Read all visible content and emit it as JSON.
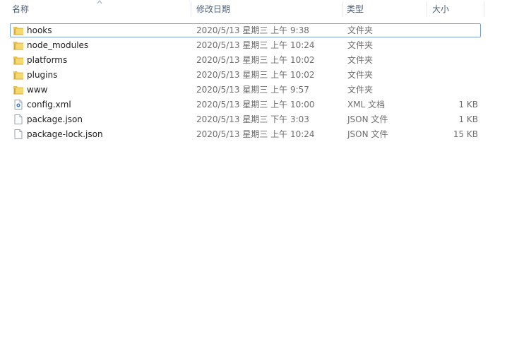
{
  "columns": {
    "name": "名称",
    "date": "修改日期",
    "type": "类型",
    "size": "大小"
  },
  "sort": {
    "column": "name",
    "direction": "ascending"
  },
  "files": [
    {
      "name": "hooks",
      "date": "2020/5/13 星期三 上午 9:38",
      "type": "文件夹",
      "size": "",
      "icon": "folder-icon",
      "focused": true
    },
    {
      "name": "node_modules",
      "date": "2020/5/13 星期三 上午 10:24",
      "type": "文件夹",
      "size": "",
      "icon": "folder-icon"
    },
    {
      "name": "platforms",
      "date": "2020/5/13 星期三 上午 10:02",
      "type": "文件夹",
      "size": "",
      "icon": "folder-icon"
    },
    {
      "name": "plugins",
      "date": "2020/5/13 星期三 上午 10:02",
      "type": "文件夹",
      "size": "",
      "icon": "folder-icon"
    },
    {
      "name": "www",
      "date": "2020/5/13 星期三 上午 9:57",
      "type": "文件夹",
      "size": "",
      "icon": "folder-icon"
    },
    {
      "name": "config.xml",
      "date": "2020/5/13 星期三 上午 10:00",
      "type": "XML 文档",
      "size": "1 KB",
      "icon": "xml-file-icon"
    },
    {
      "name": "package.json",
      "date": "2020/5/13 星期三 下午 3:03",
      "type": "JSON 文件",
      "size": "1 KB",
      "icon": "file-icon"
    },
    {
      "name": "package-lock.json",
      "date": "2020/5/13 星期三 上午 10:24",
      "type": "JSON 文件",
      "size": "15 KB",
      "icon": "file-icon"
    }
  ]
}
